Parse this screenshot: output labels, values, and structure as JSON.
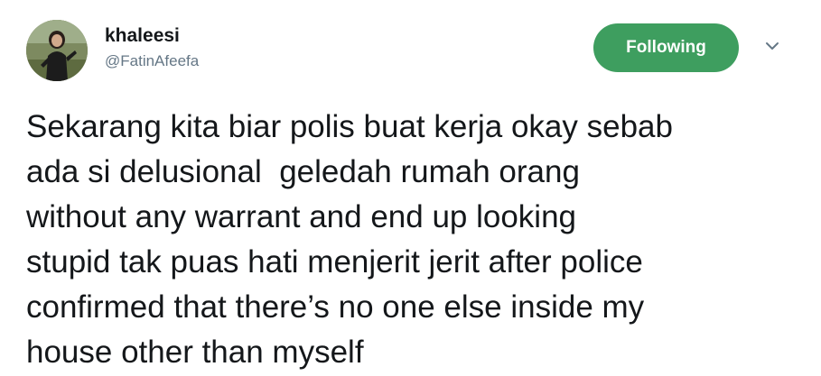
{
  "user": {
    "display_name": "khaleesi",
    "handle": "@FatinAfeefa",
    "avatar": "profile-photo"
  },
  "actions": {
    "follow_label": "Following",
    "menu_icon": "chevron-down-icon"
  },
  "tweet": {
    "text": "Sekarang kita biar polis buat kerja okay sebab\nada si delusional  geledah rumah orang\nwithout any warrant and end up looking\nstupid tak puas hati menjerit jerit after police\nconfirmed that there’s no one else inside my\nhouse other than myself"
  },
  "colors": {
    "follow_button": "#3e9e5f",
    "handle_text": "#657786",
    "primary_text": "#14171a"
  }
}
